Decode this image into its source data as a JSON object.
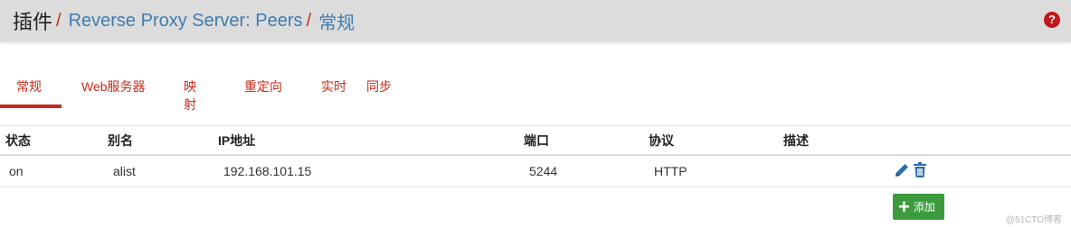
{
  "breadcrumb": {
    "root": "插件",
    "separator": "/",
    "section": "Reverse Proxy Server: Peers",
    "current": "常规"
  },
  "help_icon": "?",
  "tabs": [
    {
      "label": "常规",
      "active": true
    },
    {
      "label": "Web服务器",
      "active": false
    },
    {
      "label": "映射",
      "active": false
    },
    {
      "label": "重定向",
      "active": false
    },
    {
      "label": "实时",
      "active": false
    },
    {
      "label": "同步",
      "active": false
    }
  ],
  "table": {
    "headers": [
      "状态",
      "别名",
      "IP地址",
      "端口",
      "协议",
      "描述"
    ],
    "rows": [
      {
        "status": "on",
        "alias": "alist",
        "ip": "192.168.101.15",
        "port": "5244",
        "protocol": "HTTP",
        "description": ""
      }
    ]
  },
  "actions": {
    "edit_icon": "pencil-icon",
    "delete_icon": "trash-icon",
    "add_label": "添加"
  },
  "colors": {
    "accent_red": "#c52a1b",
    "link_blue": "#3e7cb1",
    "action_blue": "#2c6fb0",
    "add_green": "#3c9b3c"
  },
  "watermark": "@51CTO博客"
}
